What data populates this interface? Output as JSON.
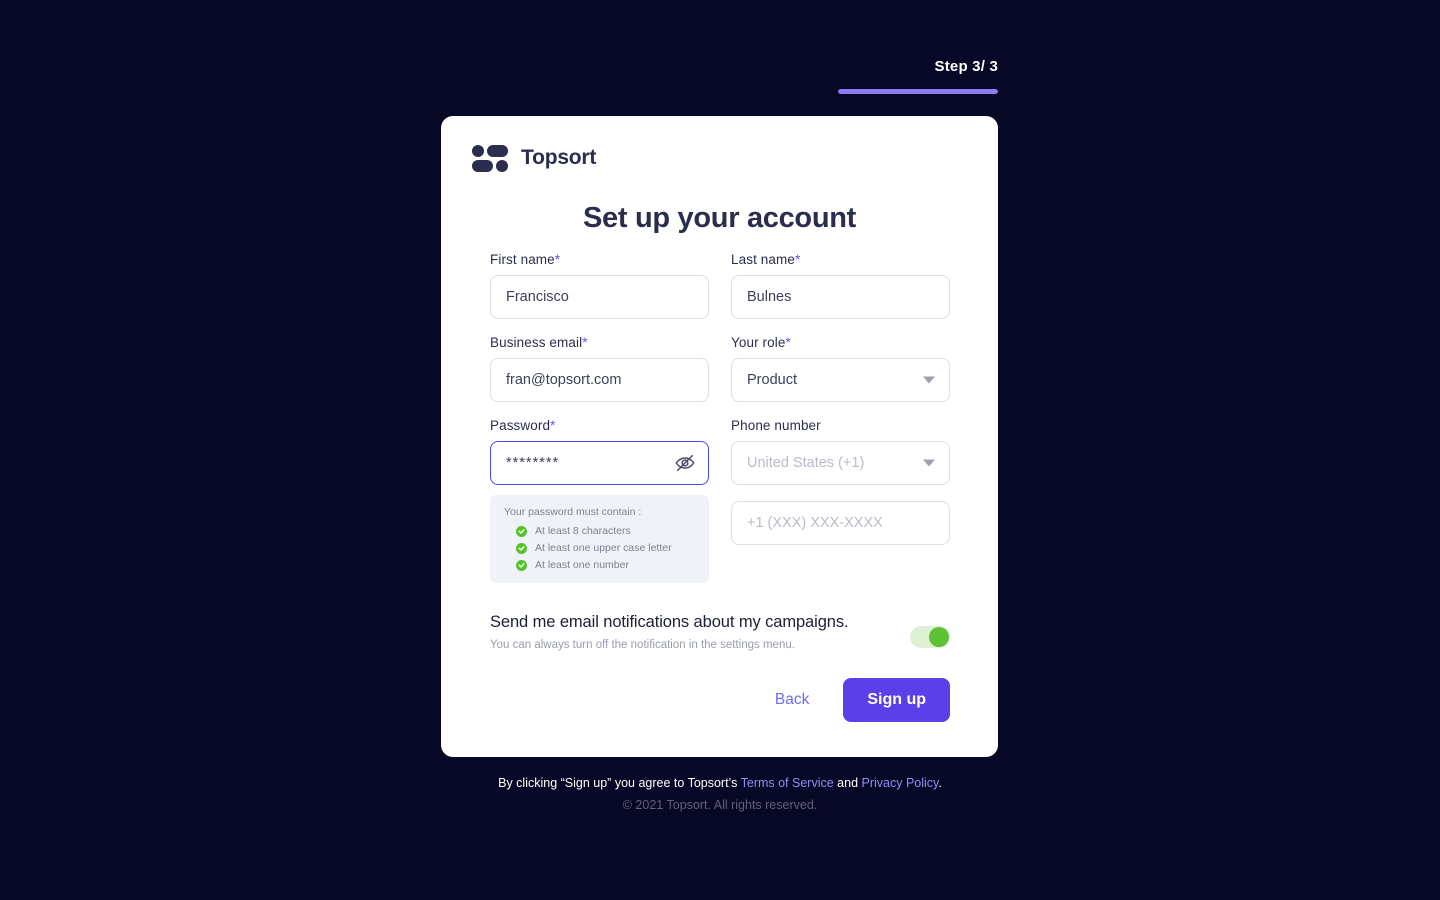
{
  "progress": {
    "step_label": "Step 3/ 3",
    "current": 3,
    "total": 3,
    "fill_percent": 100,
    "accent_color": "#8b7cf6"
  },
  "brand": {
    "name": "Topsort",
    "logo_icon": "topsort-logo-icon"
  },
  "card": {
    "title": "Set up your account"
  },
  "form": {
    "first_name": {
      "label": "First name",
      "required_mark": "*",
      "value": "Francisco",
      "placeholder": ""
    },
    "last_name": {
      "label": "Last name",
      "required_mark": "*",
      "value": "Bulnes",
      "placeholder": ""
    },
    "business_email": {
      "label": "Business email",
      "required_mark": "*",
      "value": "fran@topsort.com",
      "placeholder": ""
    },
    "role": {
      "label": "Your role",
      "required_mark": "*",
      "selected": "Product",
      "caret_icon": "chevron-down-icon"
    },
    "password": {
      "label": "Password",
      "required_mark": "*",
      "value": "********",
      "toggle_icon": "eye-off-icon",
      "focused": true,
      "hints_title": "Your password must contain :",
      "hints": [
        {
          "text": "At least 8 characters",
          "met": true
        },
        {
          "text": "At least one upper case letter",
          "met": true
        },
        {
          "text": "At least one number",
          "met": true
        }
      ],
      "hint_met_color": "#55c42a"
    },
    "phone": {
      "label": "Phone number",
      "required_mark": "",
      "country_placeholder": "United States (+1)",
      "country_caret_icon": "chevron-down-icon",
      "number_placeholder": "+1 (XXX) XXX-XXXX"
    }
  },
  "notifications": {
    "title": "Send me email notifications about my campaigns.",
    "subtitle": "You can always turn off the notification in the settings menu.",
    "toggle_on": true,
    "toggle_color": "#5cc233"
  },
  "actions": {
    "back_label": "Back",
    "signup_label": "Sign up",
    "signup_color": "#5b3fe8"
  },
  "footer": {
    "legal_prefix": "By clicking “Sign up” you agree to Topsort’s ",
    "terms_link": "Terms of Service",
    "legal_middle": " and ",
    "privacy_link": "Privacy Policy",
    "legal_suffix": ".",
    "copyright": "© 2021 Topsort. All rights reserved."
  }
}
